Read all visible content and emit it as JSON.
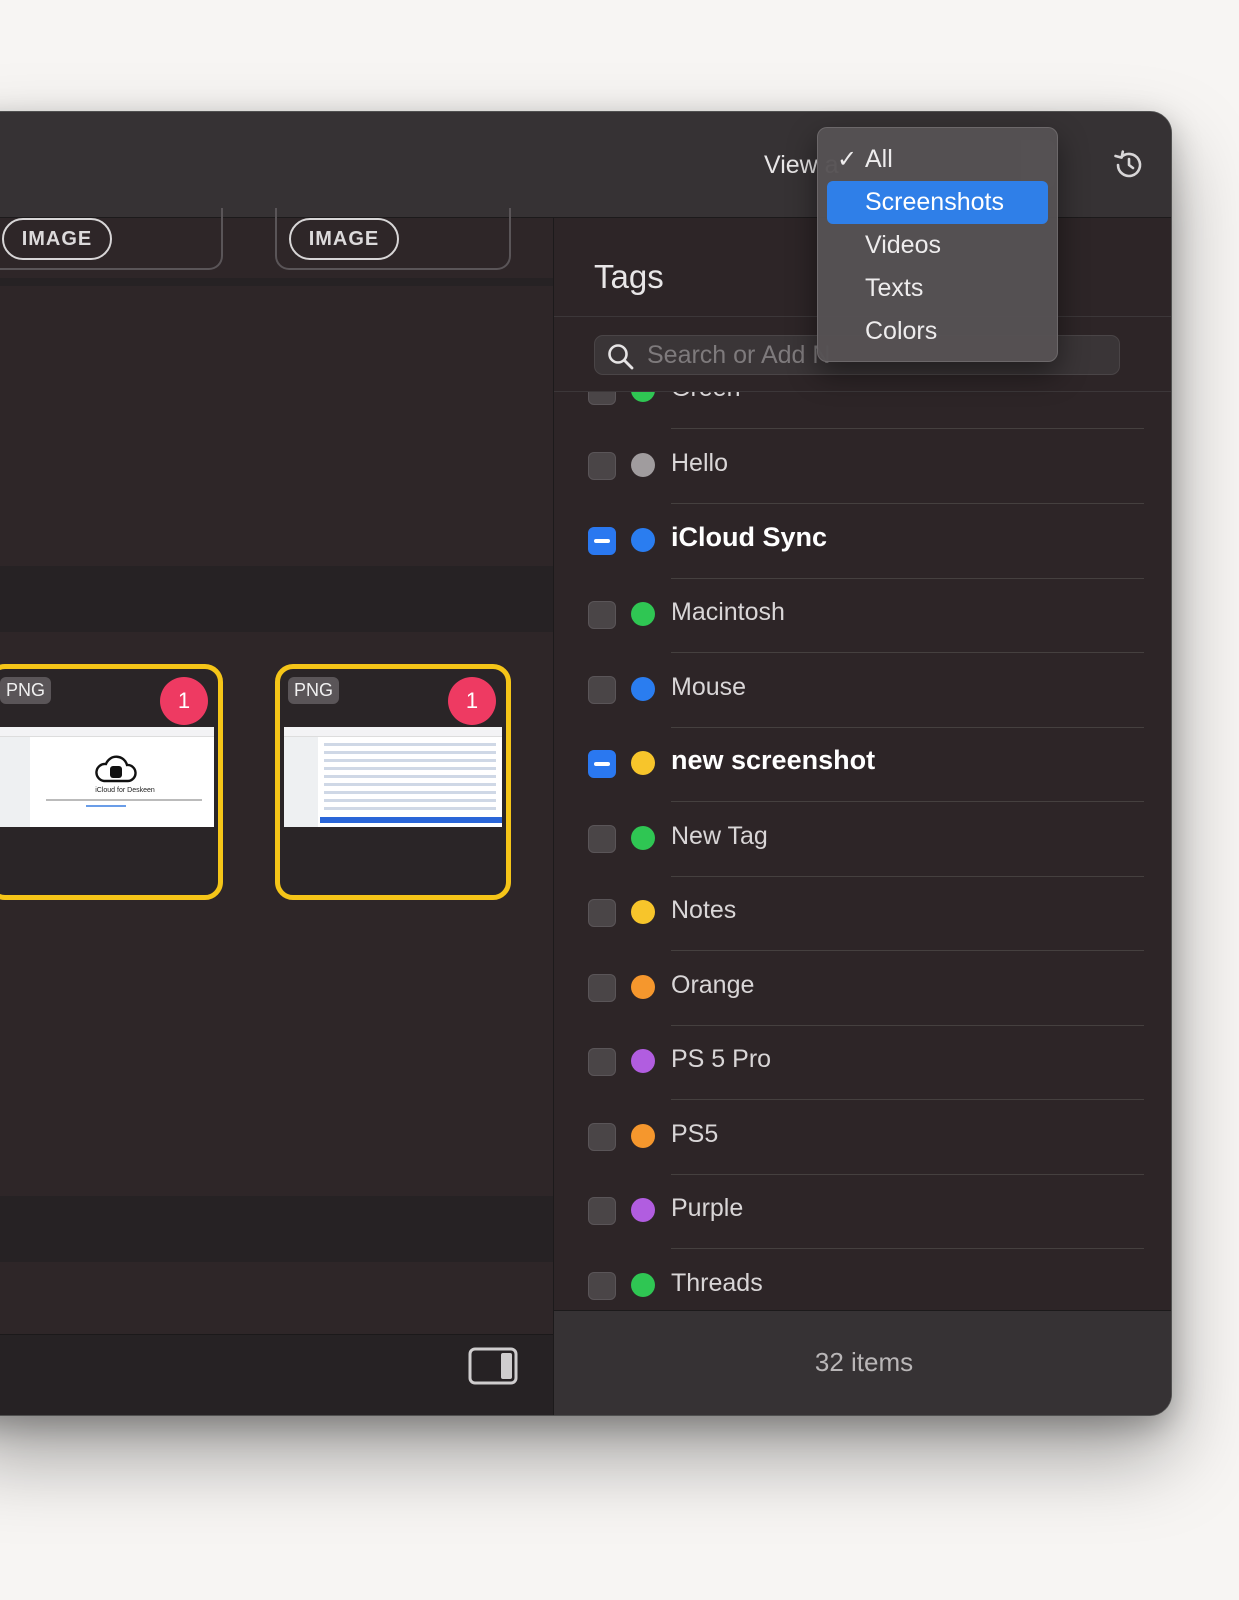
{
  "toolbar": {
    "view_as_label": "View a"
  },
  "dropdown": {
    "items": [
      {
        "label": "All",
        "checked": true
      },
      {
        "label": "Screenshots",
        "highlighted": true
      },
      {
        "label": "Videos"
      },
      {
        "label": "Texts"
      },
      {
        "label": "Colors"
      }
    ],
    "check_glyph": "✓"
  },
  "grid": {
    "kind_pills": [
      "IMAGE",
      "IMAGE"
    ],
    "cards": [
      {
        "type": "PNG",
        "badge": "1",
        "preview_caption": "iCloud for Deskeen",
        "border_color": "#f5c518"
      },
      {
        "type": "PNG",
        "badge": "1",
        "border_color": "#f5c518"
      }
    ]
  },
  "tags_panel": {
    "title": "Tags",
    "search_placeholder": "Search or Add N",
    "partial_tag": "Green",
    "tags": [
      {
        "name": "Hello",
        "color": "#a09c9e",
        "state": "unchecked"
      },
      {
        "name": "iCloud Sync",
        "color": "#2a7df0",
        "state": "mixed"
      },
      {
        "name": "Macintosh",
        "color": "#2fc653",
        "state": "unchecked"
      },
      {
        "name": "Mouse",
        "color": "#2a7df0",
        "state": "unchecked"
      },
      {
        "name": "new screenshot",
        "color": "#f7c52b",
        "state": "mixed"
      },
      {
        "name": "New Tag",
        "color": "#2fc653",
        "state": "unchecked"
      },
      {
        "name": "Notes",
        "color": "#f7c52b",
        "state": "unchecked"
      },
      {
        "name": "Orange",
        "color": "#f5972d",
        "state": "unchecked"
      },
      {
        "name": "PS 5 Pro",
        "color": "#b15de0",
        "state": "unchecked"
      },
      {
        "name": "PS5",
        "color": "#f5972d",
        "state": "unchecked"
      },
      {
        "name": "Purple",
        "color": "#b15de0",
        "state": "unchecked"
      },
      {
        "name": "Threads",
        "color": "#2fc653",
        "state": "unchecked"
      }
    ],
    "item_count": "32 items"
  },
  "icons": {
    "history": "clock-history-icon",
    "search": "magnifier-icon",
    "sidebar_toggle": "sidebar-right-icon"
  },
  "colors": {
    "accent": "#2f7fe8",
    "selection_border": "#f5c518",
    "badge": "#ee3a62"
  }
}
